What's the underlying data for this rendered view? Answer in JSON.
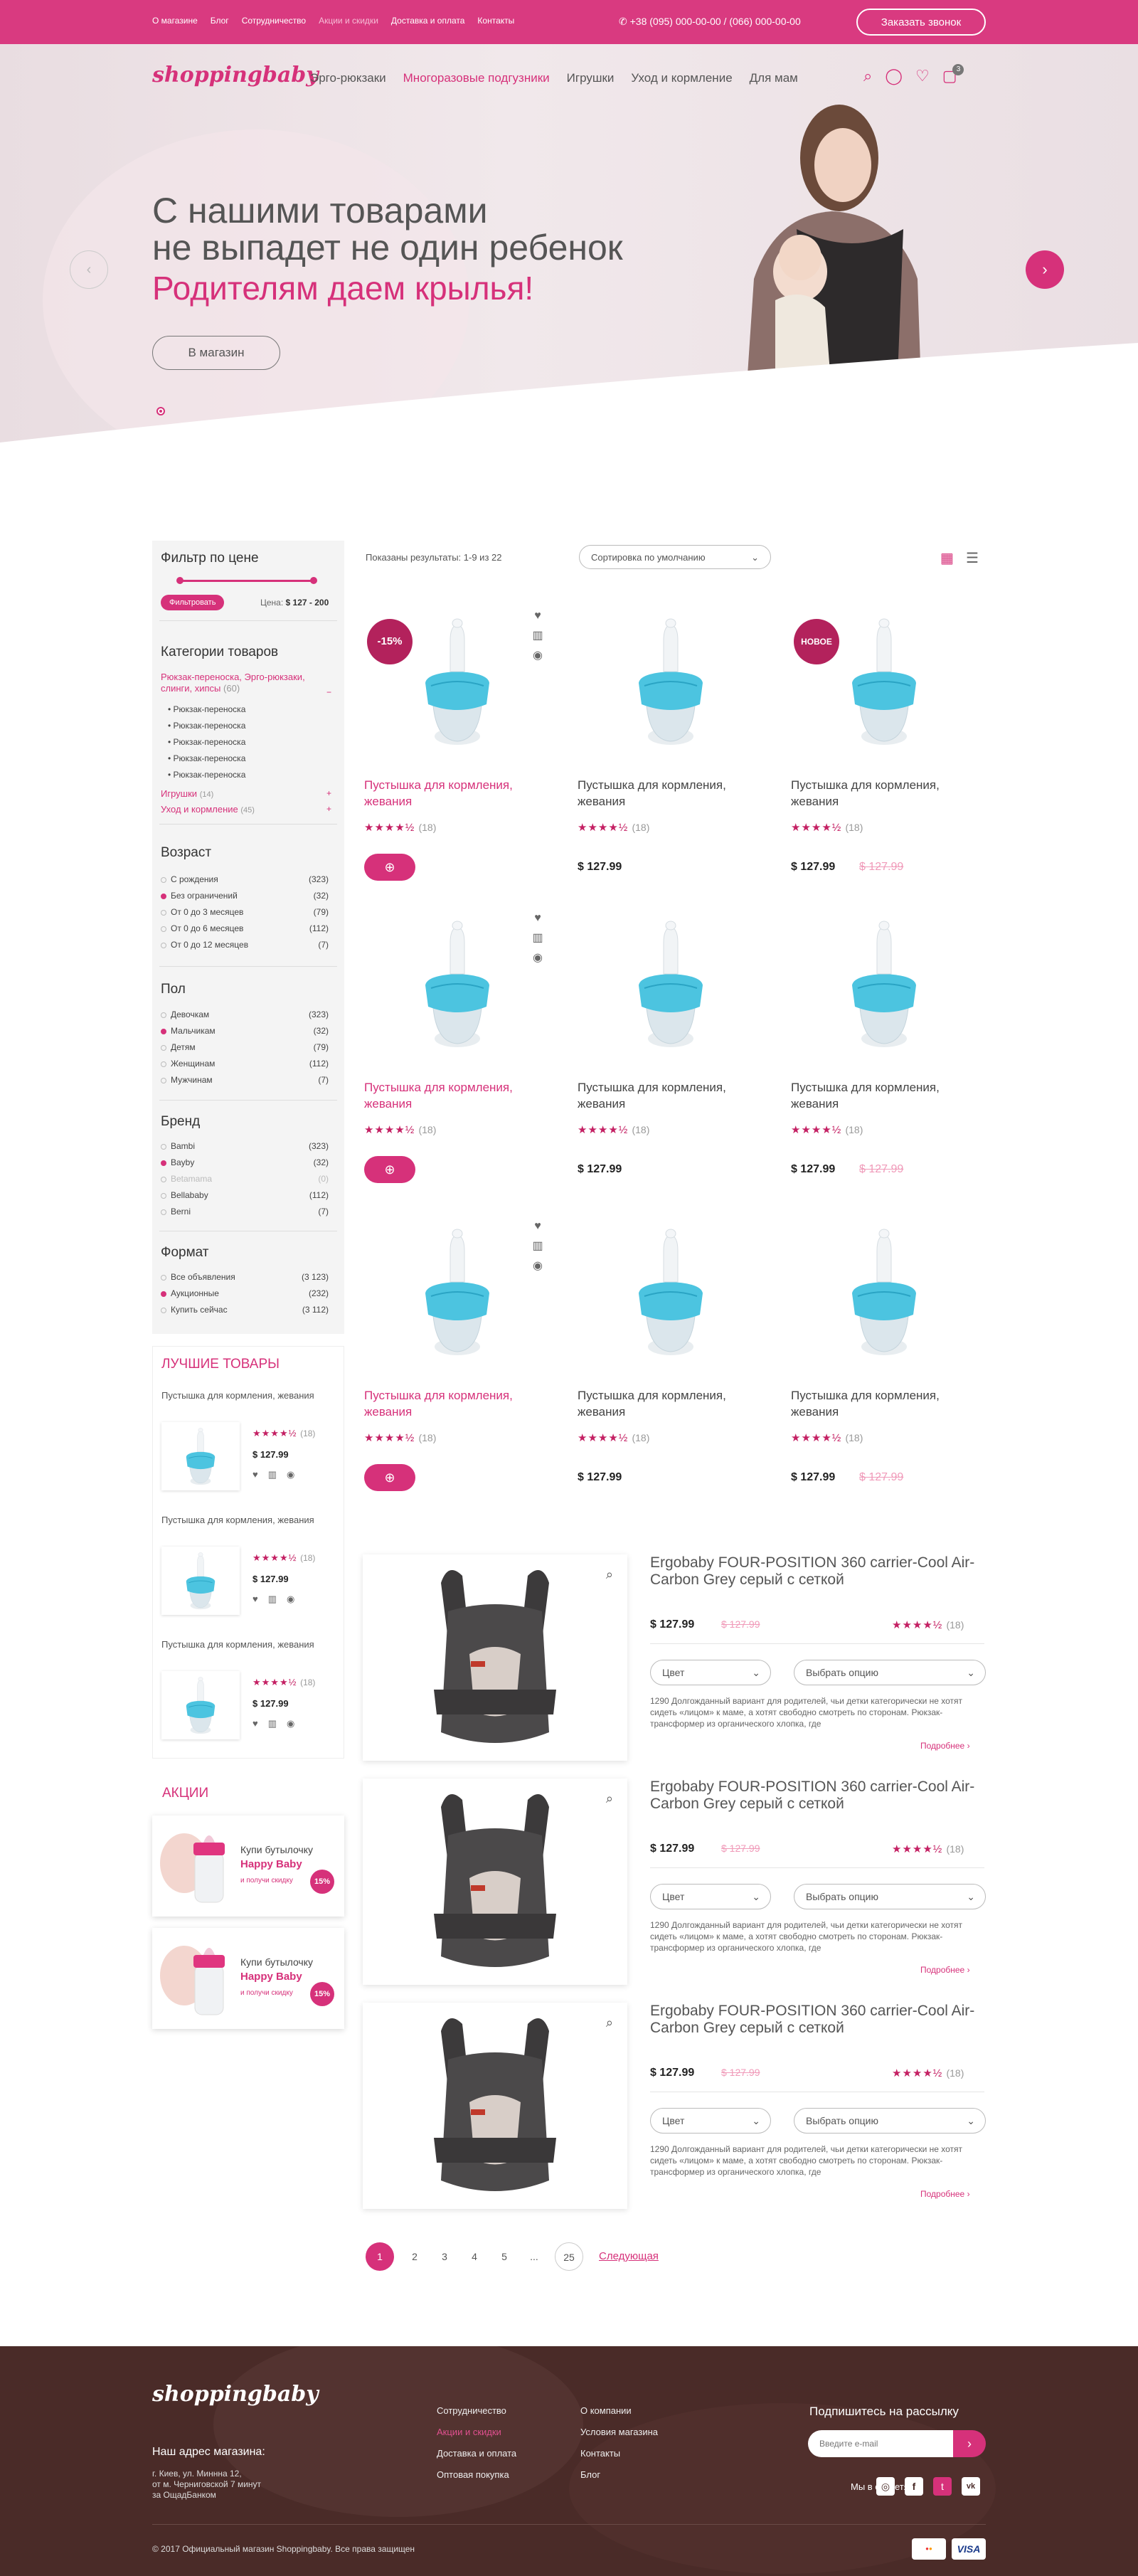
{
  "topbar": {
    "links": [
      "О магазине",
      "Блог",
      "Сотрудничество",
      "Акции и скидки",
      "Доставка и оплата",
      "Контакты"
    ],
    "phone": "+38 (095) 000-00-00 / (066) 000-00-00",
    "call_label": "Заказать звонок"
  },
  "header": {
    "logo": "shoppingbaby",
    "nav": [
      "Эрго-рюкзаки",
      "Многоразовые подгузники",
      "Игрушки",
      "Уход и кормление",
      "Для мам"
    ],
    "cart_count": "3"
  },
  "hero": {
    "line1": "С нашими товарами",
    "line2": "не выпадет не один ребенок",
    "slogan": "Родителям даем крылья!",
    "button": "В магазин",
    "prev": "‹",
    "next": "›"
  },
  "filter": {
    "title": "Фильтр по цене",
    "button": "Фильтровать",
    "price_prefix": "Цена:",
    "price_range": "$ 127 - 200"
  },
  "categories": {
    "title": "Категории товаров",
    "main": "Рюкзак-переноска, Эрго-рюкзаки, слинги, хипсы",
    "main_count": "(60)",
    "sub": [
      "Рюкзак-переноска",
      "Рюкзак-переноска",
      "Рюкзак-переноска",
      "Рюкзак-переноска",
      "Рюкзак-переноска"
    ],
    "toys": "Игрушки",
    "toys_count": "(14)",
    "care": "Уход и кормление",
    "care_count": "(45)"
  },
  "age": {
    "title": "Возраст",
    "items": [
      {
        "l": "С рождения",
        "c": "(323)"
      },
      {
        "l": "Без ограничений",
        "c": "(32)"
      },
      {
        "l": "От 0 до 3 месяцев",
        "c": "(79)"
      },
      {
        "l": "От 0 до 6 месяцев",
        "c": "(112)"
      },
      {
        "l": "От 0 до 12 месяцев",
        "c": "(7)"
      }
    ]
  },
  "gender": {
    "title": "Пол",
    "items": [
      {
        "l": "Девочкам",
        "c": "(323)"
      },
      {
        "l": "Мальчикам",
        "c": "(32)"
      },
      {
        "l": "Детям",
        "c": "(79)"
      },
      {
        "l": "Женщинам",
        "c": "(112)"
      },
      {
        "l": "Мужчинам",
        "c": "(7)"
      }
    ]
  },
  "brand": {
    "title": "Бренд",
    "items": [
      {
        "l": "Bambi",
        "c": "(323)"
      },
      {
        "l": "Bayby",
        "c": "(32)"
      },
      {
        "l": "Betamama",
        "c": "(0)"
      },
      {
        "l": "Bellababy",
        "c": "(112)"
      },
      {
        "l": "Berni",
        "c": "(7)"
      }
    ]
  },
  "format": {
    "title": "Формат",
    "items": [
      {
        "l": "Все объявления",
        "c": "(3 123)"
      },
      {
        "l": "Аукционные",
        "c": "(232)"
      },
      {
        "l": "Купить сейчас",
        "c": "(3 112)"
      }
    ]
  },
  "best": {
    "title": "ЛУЧШИЕ ТОВАРЫ",
    "items": [
      {
        "name": "Пустышка для кормления, жевания",
        "rating": "(18)",
        "price": "$ 127.99"
      },
      {
        "name": "Пустышка для кормления, жевания",
        "rating": "(18)",
        "price": "$ 127.99"
      },
      {
        "name": "Пустышка для кормления, жевания",
        "rating": "(18)",
        "price": "$ 127.99"
      }
    ]
  },
  "promo": {
    "title": "АКЦИИ",
    "items": [
      {
        "l1": "Купи бутылочку",
        "l2": "Happy Baby",
        "l3": "и получи скидку",
        "pct": "15%"
      },
      {
        "l1": "Купи бутылочку",
        "l2": "Happy Baby",
        "l3": "и получи скидку",
        "pct": "15%"
      }
    ]
  },
  "toolbar": {
    "results": "Показаны результаты: 1-9 из 22",
    "sort": "Сортировка по умолчанию"
  },
  "product": {
    "name": "Пустышка для кормления, жевания",
    "rating": "(18)",
    "price": "$ 127.99",
    "old_price": "$ 127.99",
    "badge_sale": "-15%",
    "badge_new": "НОВОЕ"
  },
  "list_item": {
    "title": "Ergobaby FOUR-POSITION 360 carrier-Cool Air-Carbon Grey серый с сеткой",
    "price": "$ 127.99",
    "old_price": "$ 127.99",
    "rating": "(18)",
    "color": "Цвет",
    "option": "Выбрать опцию",
    "desc": "1290 Долгожданный вариант для родителей, чьи детки категорически не хотят сидеть «лицом» к маме, а хотят свободно смотреть по сторонам. Рюкзак-трансформер из органического хлопка, где",
    "more": "Подробнее"
  },
  "pagination": {
    "pages": [
      "1",
      "2",
      "3",
      "4",
      "5",
      "...",
      "25"
    ],
    "next": "Следующая"
  },
  "footer": {
    "logo": "shoppingbaby",
    "addr_title": "Наш адрес магазина:",
    "addr": [
      "г. Киев, ул. Миннна 12,",
      "от м. Черниговской 7 минут",
      "за ОщадБанком"
    ],
    "col1": [
      "Сотрудничество",
      "Акции и скидки",
      "Доставка и оплата",
      "Оптовая покупка"
    ],
    "col2": [
      "О компании",
      "Условия магазина",
      "Контакты",
      "Блог"
    ],
    "subscribe": "Подпишитесь на рассылку",
    "email_ph": "Введите e-mail",
    "social": "Мы в соцсетях:",
    "copyright": "© 2017 Официальный магазин Shoppingbaby. Все права защищен",
    "pay1": "mastercard",
    "pay2": "VISA"
  },
  "colors": {
    "accent": "#d6317a",
    "footer": "#4a2b28"
  }
}
